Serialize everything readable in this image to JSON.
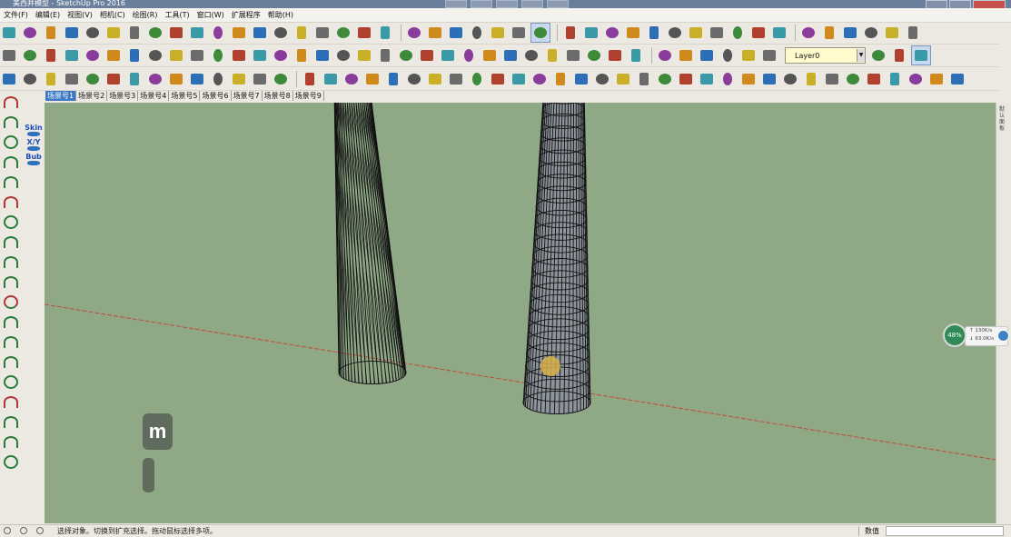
{
  "window": {
    "title": "美西井模型 - SketchUp Pro 2016"
  },
  "menu": [
    "文件(F)",
    "编辑(E)",
    "视图(V)",
    "相机(C)",
    "绘图(R)",
    "工具(T)",
    "窗口(W)",
    "扩展程序",
    "帮助(H)"
  ],
  "toolbar": {
    "layer_value": "Layer0"
  },
  "tabs": [
    "场景号1",
    "场景号2",
    "场景号3",
    "场景号4",
    "场景号5",
    "场景号6",
    "场景号7",
    "场景号8",
    "场景号9"
  ],
  "leftbar2": {
    "skin_label": "Skin",
    "xy_label": "X/Y",
    "bub_label": "Bub"
  },
  "viewport": {
    "badge_letter": "m"
  },
  "network": {
    "percent": "48%",
    "upload": "130K/s",
    "download": "63.0K/s"
  },
  "right_panel": {
    "tray_text": "默认面板"
  },
  "status": {
    "message": "选择对象。切换到扩充选择。拖动鼠标选择多项。",
    "vcb_label": "数值"
  },
  "colors": {
    "viewport_bg": "#8fa986",
    "axis_red": "#c44a3a",
    "selection_blue": "#3b78c6"
  }
}
